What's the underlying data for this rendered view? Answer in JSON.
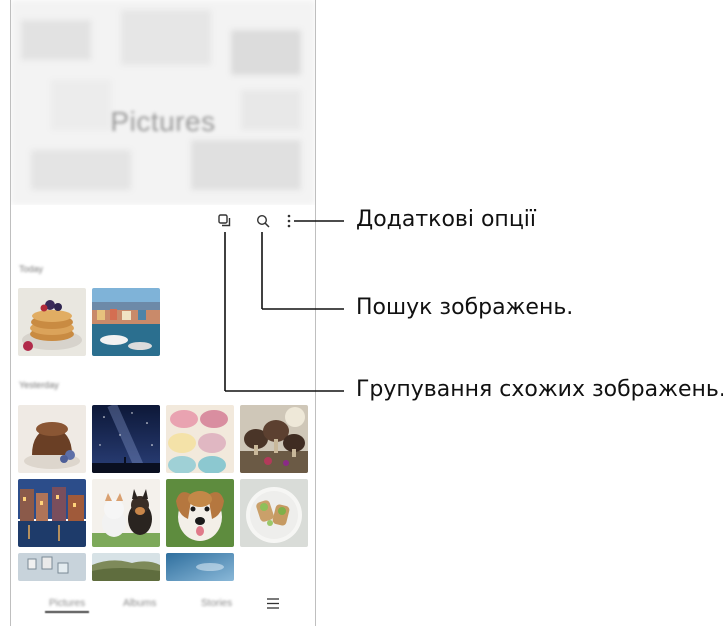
{
  "app": {
    "header_title": "Pictures",
    "sections": [
      {
        "label": "Today"
      },
      {
        "label": "Yesterday"
      }
    ],
    "bottom_nav": [
      {
        "label": "Pictures",
        "active": true
      },
      {
        "label": "Albums",
        "active": false
      },
      {
        "label": "Stories",
        "active": false
      }
    ],
    "icons": {
      "similar": "similar-images-icon",
      "search": "search-icon",
      "more": "more-options-icon",
      "menu": "menu-icon"
    }
  },
  "callouts": {
    "more_options": "Додаткові опції",
    "search": "Пошук зображень.",
    "group_similar": "Групування схожих зображень."
  },
  "colors": {
    "line": "#111111",
    "nav_active": "#444444"
  }
}
